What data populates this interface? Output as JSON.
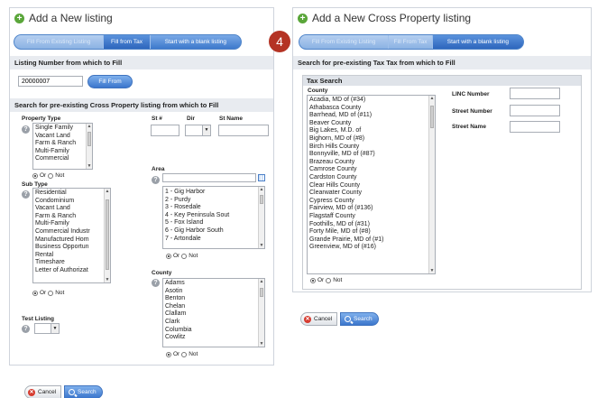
{
  "left": {
    "title": "Add a New listing",
    "fill_buttons": [
      "Fill From Existing Listing",
      "Fill from Tax",
      "Start with a blank listing"
    ],
    "listing_bar": "Listing Number from which to Fill",
    "listing_number_value": "20000007",
    "fill_from_button": "Fill From",
    "search_bar": "Search for pre-existing Cross Property listing from which to Fill",
    "property_type": {
      "label": "Property Type",
      "options": [
        "Single Family",
        "Vacant Land",
        "Farm & Ranch",
        "Multi-Family",
        "Commercial"
      ]
    },
    "st_num_label": "St #",
    "dir_label": "Dir",
    "st_name_label": "St Name",
    "area": {
      "label": "Area",
      "options": [
        "1 - Gig Harbor",
        "2 - Purdy",
        "3 - Rosedale",
        "4 - Key Peninsula Sout",
        "5 - Fox Island",
        "6 - Gig Harbor South",
        "7 - Artondale"
      ]
    },
    "sub_type": {
      "label": "Sub Type",
      "options": [
        "Residential",
        "Condominium",
        "Vacant Land",
        "Farm & Ranch",
        "Multi-Family",
        "Commercial Industr",
        "Manufactured Hom",
        "Business Opportun",
        "Rental",
        "Timeshare",
        "Letter of Authorizat"
      ]
    },
    "county": {
      "label": "County",
      "options": [
        "Adams",
        "Asotin",
        "Benton",
        "Chelan",
        "Clallam",
        "Clark",
        "Columbia",
        "Cowlitz"
      ]
    },
    "test_listing_label": "Test Listing",
    "or_label": "Or",
    "not_label": "Not",
    "cancel_label": "Cancel",
    "search_label": "Search"
  },
  "right": {
    "title": "Add a New Cross Property listing",
    "badge": "4",
    "fill_buttons": [
      "Fill From Existing Listing",
      "Fill From Tax",
      "Start with a blank listing"
    ],
    "search_bar": "Search for pre-existing Tax Tax from which to Fill",
    "tax_search_header": "Tax Search",
    "county_label": "County",
    "counties": [
      "Acadia, MD of (#34)",
      "Athabasca County",
      "Barrhead, MD of (#11)",
      "Beaver County",
      "Big Lakes, M.D. of",
      "Bighorn, MD of (#8)",
      "Birch Hills County",
      "Bonnyville, MD of (#87)",
      "Brazeau County",
      "Camrose County",
      "Cardston County",
      "Clear Hills County",
      "Clearwater County",
      "Cypress County",
      "Fairview, MD of (#136)",
      "Flagstaff County",
      "Foothills, MD of (#31)",
      "Forty Mile, MD of (#8)",
      "Grande Prairie, MD of (#1)",
      "Greenview, MD of (#16)"
    ],
    "linc_label": "LINC Number",
    "street_number_label": "Street Number",
    "street_name_label": "Street Name",
    "or_label": "Or",
    "not_label": "Not",
    "cancel_label": "Cancel",
    "search_label": "Search"
  }
}
